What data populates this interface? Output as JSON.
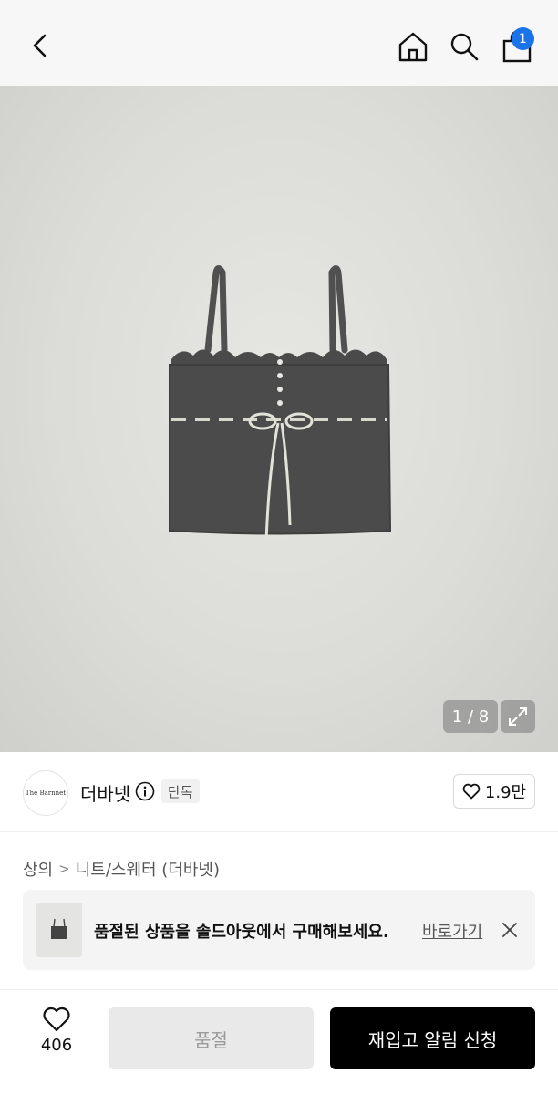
{
  "header": {
    "cart_count": "1",
    "icons": [
      "chevron-left-icon",
      "home-icon",
      "search-icon",
      "shopping-bag-icon"
    ]
  },
  "gallery": {
    "counter": "1 / 8"
  },
  "brand": {
    "logo_text": "The Barnnet",
    "name": "더바넷",
    "tag": "단독",
    "like_count": "1.9만"
  },
  "breadcrumb": {
    "category": "상의",
    "subcategory": "니트/스웨터 (더바넷)"
  },
  "banner": {
    "message": "품절된 상품을 솔드아웃에서 구매해보세요.",
    "link_label": "바로가기"
  },
  "bottom_bar": {
    "wish_count": "406",
    "soldout_label": "품절",
    "restock_label": "재입고 알림 신청"
  },
  "colors": {
    "badge": "#1a73e8",
    "primary_button": "#000000",
    "disabled_button": "#e9e9e9"
  }
}
